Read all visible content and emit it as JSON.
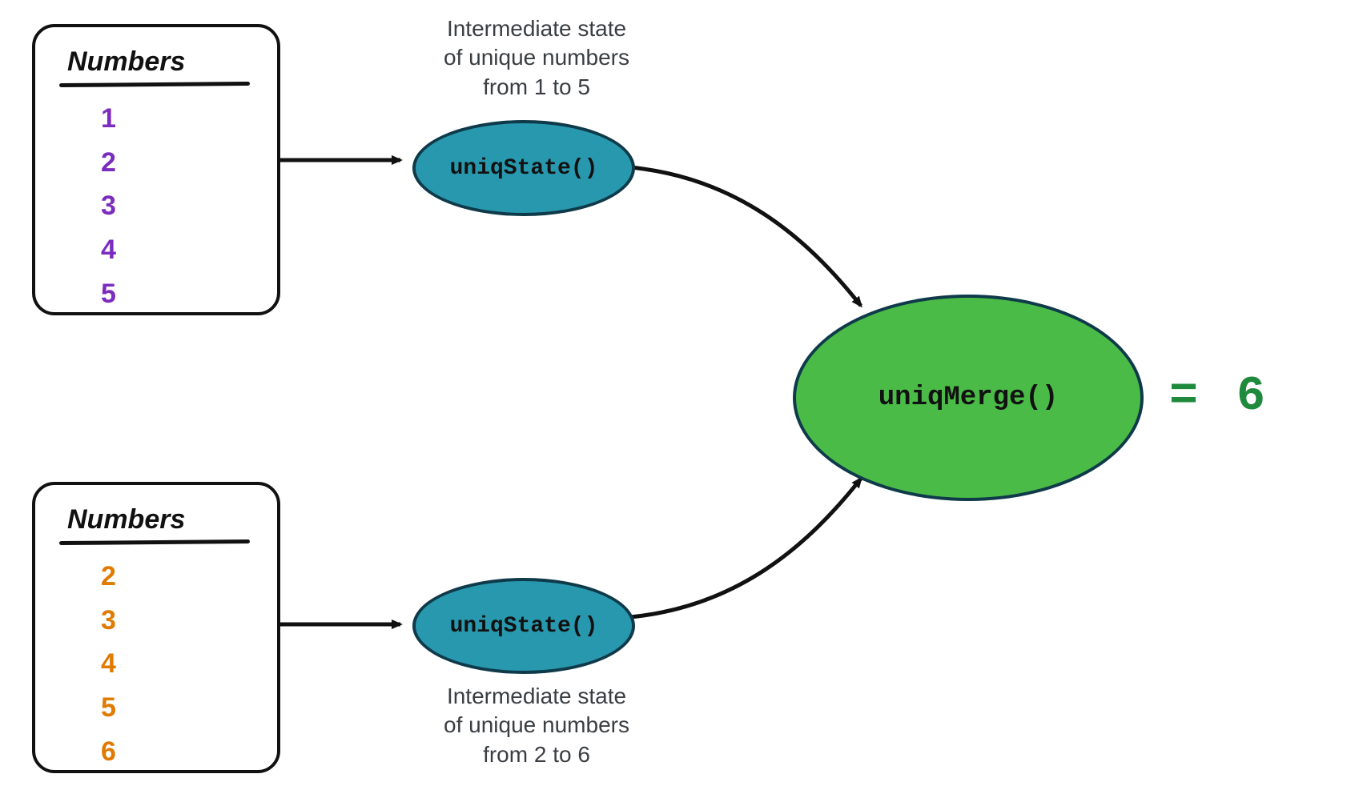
{
  "source_top": {
    "title": "Numbers",
    "values": [
      "1",
      "2",
      "3",
      "4",
      "5"
    ],
    "color": "purple"
  },
  "source_bottom": {
    "title": "Numbers",
    "values": [
      "2",
      "3",
      "4",
      "5",
      "6"
    ],
    "color": "orange"
  },
  "state_top": {
    "label": "uniqState()",
    "caption_line1": "Intermediate state",
    "caption_line2": "of unique numbers",
    "caption_line3": "from 1 to 5"
  },
  "state_bottom": {
    "label": "uniqState()",
    "caption_line1": "Intermediate state",
    "caption_line2": "of unique numbers",
    "caption_line3": "from 2 to 6"
  },
  "merge": {
    "label": "uniqMerge()",
    "result_prefix": "= ",
    "result_value": "6"
  }
}
